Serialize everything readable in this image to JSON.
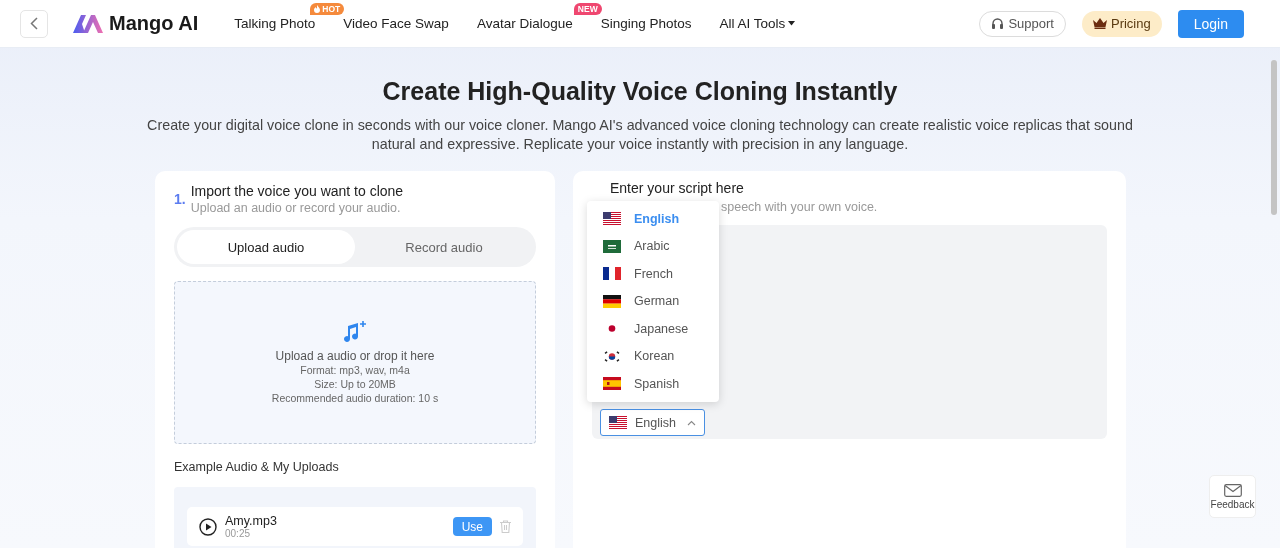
{
  "nav": {
    "logo": "Mango AI",
    "items": [
      {
        "label": "Talking Photo",
        "badge": "HOT",
        "kind": "hot"
      },
      {
        "label": "Video Face Swap"
      },
      {
        "label": "Avatar Dialogue",
        "badge": "NEW",
        "kind": "new"
      },
      {
        "label": "Singing Photos"
      },
      {
        "label": "All AI Tools",
        "kind": "menu"
      }
    ],
    "support": "Support",
    "pricing": "Pricing",
    "login": "Login"
  },
  "hero": {
    "title": "Create High-Quality Voice Cloning Instantly",
    "description": "Create your digital voice clone in seconds with our voice cloner. Mango AI's advanced voice cloning technology can create realistic voice replicas that sound natural and expressive. Replicate your voice instantly with precision in any language."
  },
  "import_card": {
    "step": "1.",
    "title": "Import the voice you want to clone",
    "subtitle": "Upload an audio or record your audio.",
    "tabs": [
      {
        "label": "Upload audio",
        "selected": true
      },
      {
        "label": "Record audio",
        "selected": false
      }
    ],
    "dropzone": {
      "heading": "Upload a audio or drop it here",
      "lines": [
        "Format: mp3, wav, m4a",
        "Size: Up to 20MB",
        "Recommended audio duration: 10 s"
      ]
    },
    "uploads_title": "Example Audio & My Uploads",
    "uploads": [
      {
        "name": "Amy.mp3",
        "duration": "00:25",
        "action": "Use"
      }
    ]
  },
  "script_card": {
    "title": "Enter your script here",
    "subtitle": "speech with your own voice.",
    "language_select": {
      "value": "English",
      "kind": "us"
    },
    "language_menu": [
      {
        "label": "English",
        "kind": "us",
        "selected": true
      },
      {
        "label": "Arabic",
        "kind": "sa",
        "selected": false
      },
      {
        "label": "French",
        "kind": "fr",
        "selected": false
      },
      {
        "label": "German",
        "kind": "de",
        "selected": false
      },
      {
        "label": "Japanese",
        "kind": "jp",
        "selected": false
      },
      {
        "label": "Korean",
        "kind": "kr",
        "selected": false
      },
      {
        "label": "Spanish",
        "kind": "es",
        "selected": false
      }
    ]
  },
  "feedback": "Feedback"
}
